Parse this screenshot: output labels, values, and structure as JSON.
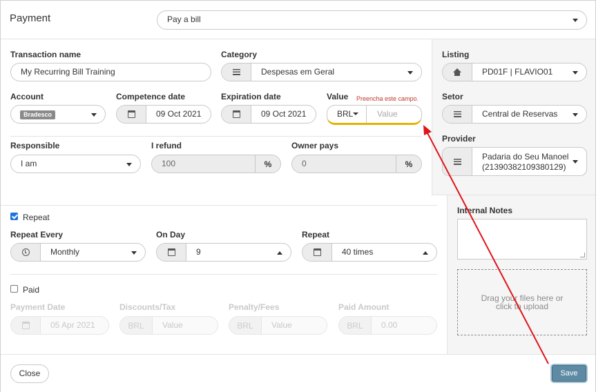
{
  "header": {
    "title": "Payment",
    "type_select": "Pay a bill"
  },
  "form": {
    "transaction_name": {
      "label": "Transaction name",
      "value": "My Recurring Bill Training"
    },
    "category": {
      "label": "Category",
      "value": "Despesas em Geral"
    },
    "account": {
      "label": "Account",
      "badge": "Bradesco"
    },
    "competence_date": {
      "label": "Competence date",
      "value": "09 Oct 2021"
    },
    "expiration_date": {
      "label": "Expiration date",
      "value": "09 Oct 2021"
    },
    "value": {
      "label": "Value",
      "currency": "BRL",
      "placeholder": "Value",
      "validation": "Preencha este campo."
    },
    "responsible": {
      "label": "Responsible",
      "value": "I am"
    },
    "i_refund": {
      "label": "I refund",
      "value": "100",
      "unit": "%"
    },
    "owner_pays": {
      "label": "Owner pays",
      "value": "0",
      "unit": "%"
    }
  },
  "side": {
    "listing": {
      "label": "Listing",
      "value": "PD01F | FLAVIO01"
    },
    "setor": {
      "label": "Setor",
      "value": "Central de Reservas"
    },
    "provider": {
      "label": "Provider",
      "line1": "Padaria do Seu Manoel",
      "line2": "(21390382109380129)"
    },
    "notes": {
      "label": "Internal Notes"
    },
    "dropzone": "Drag your files here or click to upload"
  },
  "repeat": {
    "checkbox_label": "Repeat",
    "checked": true,
    "every": {
      "label": "Repeat Every",
      "value": "Monthly"
    },
    "on_day": {
      "label": "On Day",
      "value": "9"
    },
    "times": {
      "label": "Repeat",
      "value": "40 times"
    }
  },
  "paid": {
    "checkbox_label": "Paid",
    "checked": false,
    "payment_date": {
      "label": "Payment Date",
      "value": "05 Apr 2021"
    },
    "discounts": {
      "label": "Discounts/Tax",
      "currency": "BRL",
      "placeholder": "Value"
    },
    "penalty": {
      "label": "Penalty/Fees",
      "currency": "BRL",
      "placeholder": "Value"
    },
    "paid_amount": {
      "label": "Paid Amount",
      "currency": "BRL",
      "value": "0.00"
    }
  },
  "footer": {
    "close": "Close",
    "save": "Save"
  },
  "colors": {
    "accent_save": "#5e8aa3",
    "validation_underline": "#e0b400",
    "annotation_arrow": "#e0141a",
    "checkbox": "#1d73d9"
  },
  "icons": [
    "list-icon",
    "calendar-icon",
    "clock-icon",
    "home-icon",
    "chevron-down-icon",
    "chevron-up-icon",
    "checkbox-icon"
  ]
}
